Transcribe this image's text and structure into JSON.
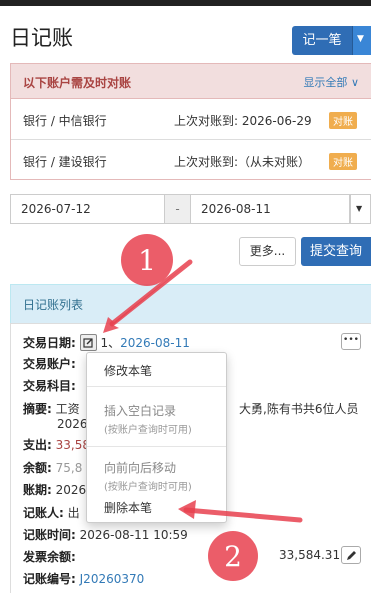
{
  "header": {
    "title": "日记账",
    "add_label": "记一笔"
  },
  "alert": {
    "title": "以下账户需及时对账",
    "show_all": "显示全部",
    "rows": [
      {
        "account": "银行 / 中信银行",
        "last": "上次对账到:  2026-06-29",
        "badge": "对账"
      },
      {
        "account": "银行 / 建设银行",
        "last": "上次对账到:（从未对账）",
        "badge": "对账"
      }
    ]
  },
  "filter": {
    "start": "2026-07-12",
    "sep": "-",
    "end": "2026-08-11",
    "more": "更多...",
    "submit": "提交查询"
  },
  "list": {
    "title": "日记账列表"
  },
  "entry": {
    "date_label": "交易日期:",
    "index": "1、",
    "date": "2026-08-11",
    "account_label": "交易账户:",
    "subject_label": "交易科目:",
    "summary_label": "摘要:",
    "summary_a": "工资",
    "summary_b": "大勇,陈有书共6位人员",
    "summary_c": "2026",
    "expense_label": "支出:",
    "expense": "33,58",
    "balance_label": "余额:",
    "balance": "75,8",
    "period_label": "账期:",
    "period": "2026",
    "recorder_label": "记账人:",
    "recorder": "出",
    "time_label": "记账时间:",
    "time": "2026-08-11 10:59",
    "invoice_label": "发票余额:",
    "invoice": "33,584.31",
    "number_label": "记账编号:",
    "number": "J20260370",
    "dots": "•••"
  },
  "menu": {
    "edit": "修改本笔",
    "insert": "插入空白记录",
    "insert_hint": "(按账户查询时可用)",
    "move": "向前向后移动",
    "move_hint": "(按账户查询时可用)",
    "delete": "删除本笔"
  },
  "annotations": {
    "one": "1",
    "two": "2",
    "arrow_color": "#e8414f"
  },
  "colors": {
    "primary": "#2f6db5",
    "warning": "#f0ad4e",
    "link": "#337ab7",
    "danger_bg": "#f2dede",
    "info_bg": "#d9edf7"
  }
}
